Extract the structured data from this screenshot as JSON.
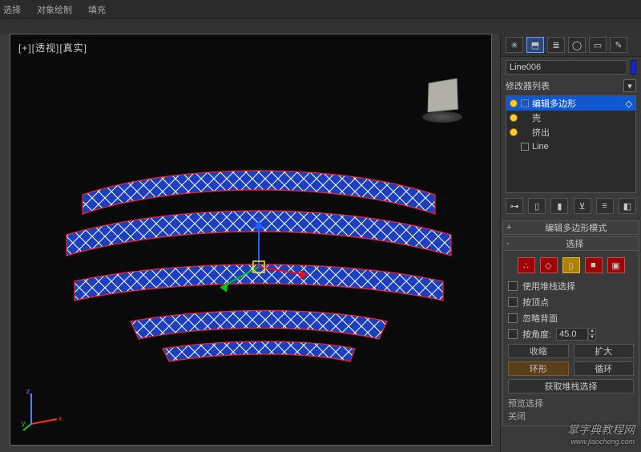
{
  "menubar": {
    "item1": "选择",
    "item2": "对象绘制",
    "item3": "填充"
  },
  "viewport": {
    "label": "[+][透视][真实]"
  },
  "object_name": "Line006",
  "mod_list_label": "修改器列表",
  "stack": {
    "items": [
      {
        "bulb": true,
        "icon": "box",
        "label": "编辑多边形",
        "selected": true,
        "subicon": "diamond"
      },
      {
        "bulb": true,
        "icon": "none",
        "label": "壳",
        "selected": false
      },
      {
        "bulb": true,
        "icon": "none",
        "label": "挤出",
        "selected": false
      },
      {
        "bulb": false,
        "icon": "box",
        "label": "Line",
        "selected": false
      }
    ]
  },
  "rollouts": {
    "mode": {
      "sign": "+",
      "title": "编辑多边形模式"
    },
    "select": {
      "sign": "-",
      "title": "选择",
      "use_stack": "使用堆栈选择",
      "by_vertex": "按顶点",
      "ignore_backfacing": "忽略背面",
      "by_angle": "按角度:",
      "angle_value": "45.0",
      "shrink": "收缩",
      "grow": "扩大",
      "ring": "环形",
      "loop": "循环",
      "get_stack": "获取堆栈选择",
      "preview_prefix": "预览选择",
      "close_prefix": "关闭"
    }
  },
  "watermark": {
    "line1": "掌字典教程网",
    "line2": "www.jiaocheng.com"
  },
  "icons": {
    "tabs": [
      "sun",
      "arc",
      "bar",
      "sphere",
      "screen",
      "wrench"
    ],
    "stack_btns": [
      "pin",
      "align1",
      "align2",
      "cage",
      "hier",
      "cfg"
    ]
  }
}
